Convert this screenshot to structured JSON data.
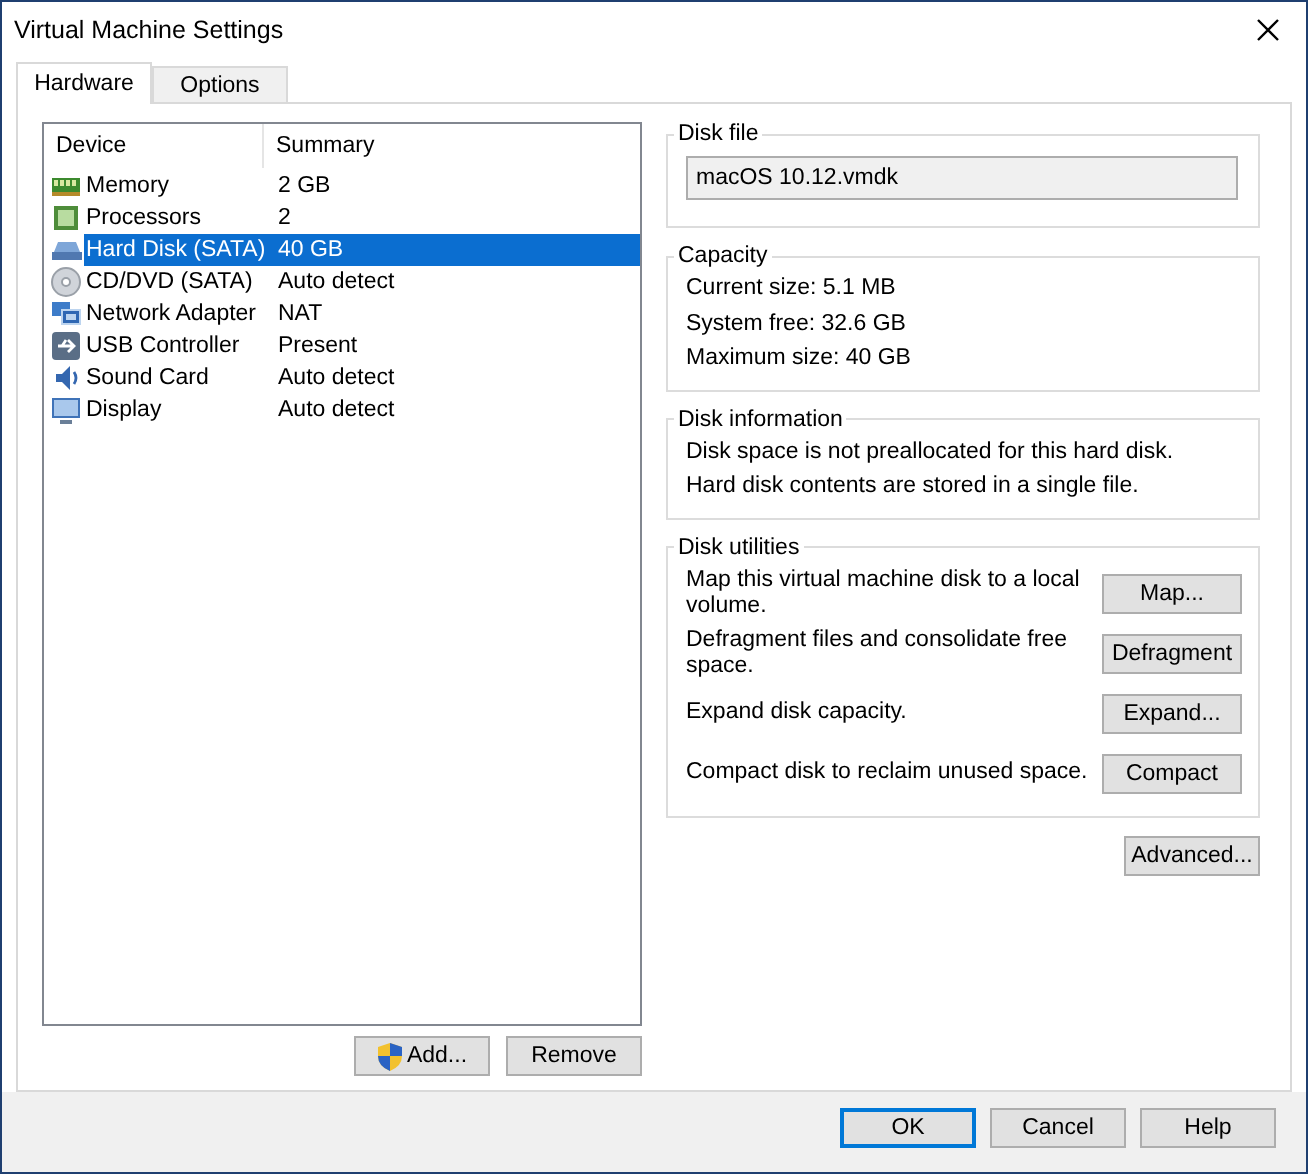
{
  "window": {
    "title": "Virtual Machine Settings"
  },
  "tabs": [
    {
      "label": "Hardware",
      "selected": true
    },
    {
      "label": "Options",
      "selected": false
    }
  ],
  "device_list": {
    "columns": [
      "Device",
      "Summary"
    ],
    "rows": [
      {
        "kind": "memory",
        "device": "Memory",
        "summary": "2 GB",
        "selected": false
      },
      {
        "kind": "processor",
        "device": "Processors",
        "summary": "2",
        "selected": false
      },
      {
        "kind": "disk",
        "device": "Hard Disk (SATA)",
        "summary": "40 GB",
        "selected": true
      },
      {
        "kind": "cdrom",
        "device": "CD/DVD (SATA)",
        "summary": "Auto detect",
        "selected": false
      },
      {
        "kind": "network",
        "device": "Network Adapter",
        "summary": "NAT",
        "selected": false
      },
      {
        "kind": "usb",
        "device": "USB Controller",
        "summary": "Present",
        "selected": false
      },
      {
        "kind": "sound",
        "device": "Sound Card",
        "summary": "Auto detect",
        "selected": false
      },
      {
        "kind": "display",
        "device": "Display",
        "summary": "Auto detect",
        "selected": false
      }
    ]
  },
  "list_buttons": [
    {
      "label": "Add...",
      "shield": true
    },
    {
      "label": "Remove",
      "shield": false
    }
  ],
  "disk_file": {
    "title": "Disk file",
    "value": "macOS 10.12.vmdk"
  },
  "capacity": {
    "title": "Capacity",
    "lines": [
      "Current size: 5.1 MB",
      "System free: 32.6 GB",
      "Maximum size: 40 GB"
    ]
  },
  "disk_information": {
    "title": "Disk information",
    "lines": [
      "Disk space is not preallocated for this hard disk.",
      "Hard disk contents are stored in a single file."
    ]
  },
  "disk_utilities": {
    "title": "Disk utilities",
    "actions": [
      {
        "description": "Map this virtual machine disk to a local volume.",
        "button": "Map..."
      },
      {
        "description": "Defragment files and consolidate free space.",
        "button": "Defragment"
      },
      {
        "description": "Expand disk capacity.",
        "button": "Expand..."
      },
      {
        "description": "Compact disk to reclaim unused space.",
        "button": "Compact"
      }
    ]
  },
  "advanced_button": "Advanced...",
  "footer_buttons": [
    {
      "label": "OK",
      "default": true
    },
    {
      "label": "Cancel",
      "default": false
    },
    {
      "label": "Help",
      "default": false
    }
  ]
}
